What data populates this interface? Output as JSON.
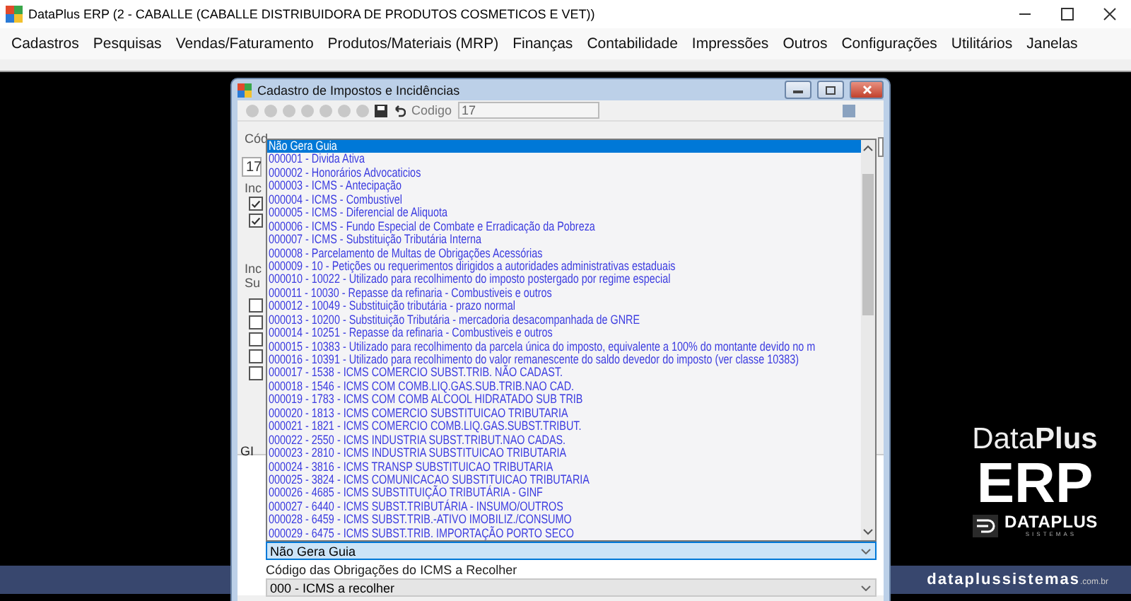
{
  "window": {
    "title": "DataPlus ERP (2 - CABALLE  (CABALLE DISTRIBUIDORA DE PRODUTOS COSMETICOS E VET))"
  },
  "menu": [
    {
      "label": "Cadastros"
    },
    {
      "label": "Pesquisas"
    },
    {
      "label": "Vendas/Faturamento"
    },
    {
      "label": "Produtos/Materiais (MRP)"
    },
    {
      "label": "Finanças"
    },
    {
      "label": "Contabilidade"
    },
    {
      "label": "Impressões"
    },
    {
      "label": "Outros"
    },
    {
      "label": "Configurações"
    },
    {
      "label": "Utilitários"
    },
    {
      "label": "Janelas"
    }
  ],
  "dialog": {
    "title": "Cadastro de Impostos e Incidências",
    "toolbar": {
      "field_label": "Codigo",
      "field_value": "17"
    },
    "background": {
      "code_label": "Cód",
      "code_value": "17",
      "group_1_label": "Inc",
      "group_1_checks": [
        {
          "checked": true
        },
        {
          "checked": true
        }
      ],
      "group_2_label": "Inc",
      "group_2_sublabel": "Su",
      "group_2_checks": [
        {
          "checked": false
        },
        {
          "checked": false
        },
        {
          "checked": false
        },
        {
          "checked": false
        },
        {
          "checked": false
        }
      ],
      "tab_label": "GI"
    },
    "guia_dropdown": {
      "value": "Não Gera Guia",
      "options": [
        {
          "label": "Não Gera Guia",
          "selected": true
        },
        {
          "label": "000001 - Divida Ativa",
          "selected": false
        },
        {
          "label": "000002 - Honorários Advocaticios",
          "selected": false
        },
        {
          "label": "000003 - ICMS - Antecipação",
          "selected": false
        },
        {
          "label": "000004 - ICMS - Combustivel",
          "selected": false
        },
        {
          "label": "000005 - ICMS - Diferencial de Aliquota",
          "selected": false
        },
        {
          "label": "000006 - ICMS - Fundo Especial de Combate e Erradicação da Pobreza",
          "selected": false
        },
        {
          "label": "000007 - ICMS - Substituição Tributária Interna",
          "selected": false
        },
        {
          "label": "000008 - Parcelamento de Multas de Obrigações Acessórias",
          "selected": false
        },
        {
          "label": "000009 - 10 - Petições ou requerimentos dirigidos a autoridades administrativas estaduais",
          "selected": false
        },
        {
          "label": "000010 - 10022 - Utilizado para recolhimento do imposto postergado por regime especial",
          "selected": false
        },
        {
          "label": "000011 - 10030 - Repasse da refinaria - Combustiveis e outros",
          "selected": false
        },
        {
          "label": "000012 - 10049 - Substituição tributária - prazo normal",
          "selected": false
        },
        {
          "label": "000013 - 10200 - Substituição Tributária - mercadoria desacompanhada de GNRE",
          "selected": false
        },
        {
          "label": "000014 - 10251 - Repasse da refinaria - Combustiveis e outros",
          "selected": false
        },
        {
          "label": "000015 - 10383 - Utilizado para recolhimento da parcela única do imposto, equivalente a 100% do montante devido no m",
          "selected": false
        },
        {
          "label": "000016 - 10391 - Utilizado para recolhimento do valor remanescente do saldo devedor do imposto (ver classe 10383)",
          "selected": false
        },
        {
          "label": "000017 - 1538 - ICMS COMERCIO SUBST.TRIB. NÃO CADAST.",
          "selected": false
        },
        {
          "label": "000018 - 1546 - ICMS COM COMB.LIQ.GAS.SUB.TRIB.NAO CAD.",
          "selected": false
        },
        {
          "label": "000019 - 1783 - ICMS COM COMB ALCOOL HIDRATADO SUB TRIB",
          "selected": false
        },
        {
          "label": "000020 - 1813 - ICMS COMERCIO SUBSTITUICAO TRIBUTARIA",
          "selected": false
        },
        {
          "label": "000021 - 1821 - ICMS COMERCIO COMB.LIQ.GAS.SUBST.TRIBUT.",
          "selected": false
        },
        {
          "label": "000022 - 2550 - ICMS INDUSTRIA SUBST.TRIBUT.NAO CADAS.",
          "selected": false
        },
        {
          "label": "000023 - 2810 - ICMS INDUSTRIA SUBSTITUICAO TRIBUTARIA",
          "selected": false
        },
        {
          "label": "000024 - 3816 - ICMS TRANSP SUBSTITUICAO TRIBUTARIA",
          "selected": false
        },
        {
          "label": "000025 - 3824 - ICMS COMUNICACAO SUBSTITUICAO TRIBUTARIA",
          "selected": false
        },
        {
          "label": "000026 - 4685 - ICMS SUBSTITUIÇÃO TRIBUTÁRIA - GINF",
          "selected": false
        },
        {
          "label": "000027 - 6440 - ICMS SUBST.TRIBUTÁRIA - INSUMO/OUTROS",
          "selected": false
        },
        {
          "label": "000028 - 6459 - ICMS SUBST.TRIB.-ATIVO IMOBILIZ./CONSUMO",
          "selected": false
        },
        {
          "label": "000029 - 6475 - ICMS SUBST.TRIB. IMPORTAÇÃO PORTO SECO",
          "selected": false
        }
      ]
    },
    "obrigacoes": {
      "label": "Código das Obrigações do ICMS a Recolher",
      "value": "000 - ICMS a recolher"
    }
  },
  "logo": {
    "brand": "Data**Plus**",
    "product": "ERP",
    "company": "DATAPLUS",
    "company_tag": "SISTEMAS",
    "site": "dataplussistemas",
    "site_suffix": ".com.br"
  }
}
